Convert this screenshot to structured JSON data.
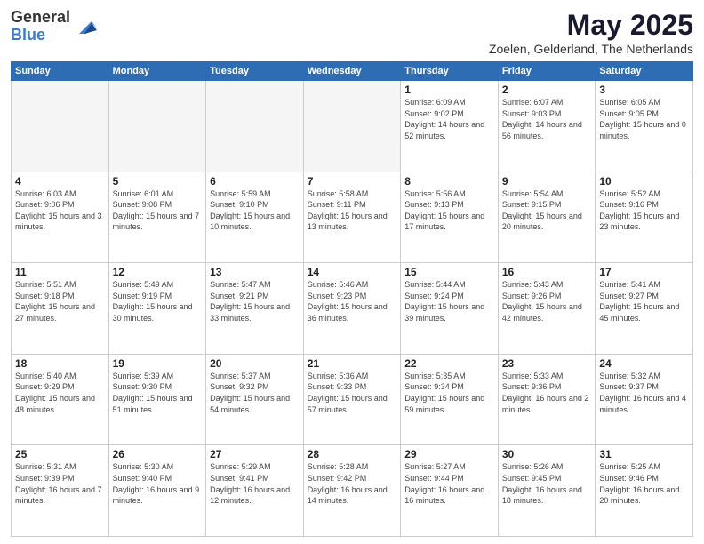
{
  "header": {
    "logo_general": "General",
    "logo_blue": "Blue",
    "title": "May 2025",
    "subtitle": "Zoelen, Gelderland, The Netherlands"
  },
  "days_of_week": [
    "Sunday",
    "Monday",
    "Tuesday",
    "Wednesday",
    "Thursday",
    "Friday",
    "Saturday"
  ],
  "weeks": [
    [
      {
        "day": "",
        "info": ""
      },
      {
        "day": "",
        "info": ""
      },
      {
        "day": "",
        "info": ""
      },
      {
        "day": "",
        "info": ""
      },
      {
        "day": "1",
        "info": "Sunrise: 6:09 AM\nSunset: 9:02 PM\nDaylight: 14 hours and 52 minutes."
      },
      {
        "day": "2",
        "info": "Sunrise: 6:07 AM\nSunset: 9:03 PM\nDaylight: 14 hours and 56 minutes."
      },
      {
        "day": "3",
        "info": "Sunrise: 6:05 AM\nSunset: 9:05 PM\nDaylight: 15 hours and 0 minutes."
      }
    ],
    [
      {
        "day": "4",
        "info": "Sunrise: 6:03 AM\nSunset: 9:06 PM\nDaylight: 15 hours and 3 minutes."
      },
      {
        "day": "5",
        "info": "Sunrise: 6:01 AM\nSunset: 9:08 PM\nDaylight: 15 hours and 7 minutes."
      },
      {
        "day": "6",
        "info": "Sunrise: 5:59 AM\nSunset: 9:10 PM\nDaylight: 15 hours and 10 minutes."
      },
      {
        "day": "7",
        "info": "Sunrise: 5:58 AM\nSunset: 9:11 PM\nDaylight: 15 hours and 13 minutes."
      },
      {
        "day": "8",
        "info": "Sunrise: 5:56 AM\nSunset: 9:13 PM\nDaylight: 15 hours and 17 minutes."
      },
      {
        "day": "9",
        "info": "Sunrise: 5:54 AM\nSunset: 9:15 PM\nDaylight: 15 hours and 20 minutes."
      },
      {
        "day": "10",
        "info": "Sunrise: 5:52 AM\nSunset: 9:16 PM\nDaylight: 15 hours and 23 minutes."
      }
    ],
    [
      {
        "day": "11",
        "info": "Sunrise: 5:51 AM\nSunset: 9:18 PM\nDaylight: 15 hours and 27 minutes."
      },
      {
        "day": "12",
        "info": "Sunrise: 5:49 AM\nSunset: 9:19 PM\nDaylight: 15 hours and 30 minutes."
      },
      {
        "day": "13",
        "info": "Sunrise: 5:47 AM\nSunset: 9:21 PM\nDaylight: 15 hours and 33 minutes."
      },
      {
        "day": "14",
        "info": "Sunrise: 5:46 AM\nSunset: 9:23 PM\nDaylight: 15 hours and 36 minutes."
      },
      {
        "day": "15",
        "info": "Sunrise: 5:44 AM\nSunset: 9:24 PM\nDaylight: 15 hours and 39 minutes."
      },
      {
        "day": "16",
        "info": "Sunrise: 5:43 AM\nSunset: 9:26 PM\nDaylight: 15 hours and 42 minutes."
      },
      {
        "day": "17",
        "info": "Sunrise: 5:41 AM\nSunset: 9:27 PM\nDaylight: 15 hours and 45 minutes."
      }
    ],
    [
      {
        "day": "18",
        "info": "Sunrise: 5:40 AM\nSunset: 9:29 PM\nDaylight: 15 hours and 48 minutes."
      },
      {
        "day": "19",
        "info": "Sunrise: 5:39 AM\nSunset: 9:30 PM\nDaylight: 15 hours and 51 minutes."
      },
      {
        "day": "20",
        "info": "Sunrise: 5:37 AM\nSunset: 9:32 PM\nDaylight: 15 hours and 54 minutes."
      },
      {
        "day": "21",
        "info": "Sunrise: 5:36 AM\nSunset: 9:33 PM\nDaylight: 15 hours and 57 minutes."
      },
      {
        "day": "22",
        "info": "Sunrise: 5:35 AM\nSunset: 9:34 PM\nDaylight: 15 hours and 59 minutes."
      },
      {
        "day": "23",
        "info": "Sunrise: 5:33 AM\nSunset: 9:36 PM\nDaylight: 16 hours and 2 minutes."
      },
      {
        "day": "24",
        "info": "Sunrise: 5:32 AM\nSunset: 9:37 PM\nDaylight: 16 hours and 4 minutes."
      }
    ],
    [
      {
        "day": "25",
        "info": "Sunrise: 5:31 AM\nSunset: 9:39 PM\nDaylight: 16 hours and 7 minutes."
      },
      {
        "day": "26",
        "info": "Sunrise: 5:30 AM\nSunset: 9:40 PM\nDaylight: 16 hours and 9 minutes."
      },
      {
        "day": "27",
        "info": "Sunrise: 5:29 AM\nSunset: 9:41 PM\nDaylight: 16 hours and 12 minutes."
      },
      {
        "day": "28",
        "info": "Sunrise: 5:28 AM\nSunset: 9:42 PM\nDaylight: 16 hours and 14 minutes."
      },
      {
        "day": "29",
        "info": "Sunrise: 5:27 AM\nSunset: 9:44 PM\nDaylight: 16 hours and 16 minutes."
      },
      {
        "day": "30",
        "info": "Sunrise: 5:26 AM\nSunset: 9:45 PM\nDaylight: 16 hours and 18 minutes."
      },
      {
        "day": "31",
        "info": "Sunrise: 5:25 AM\nSunset: 9:46 PM\nDaylight: 16 hours and 20 minutes."
      }
    ]
  ]
}
